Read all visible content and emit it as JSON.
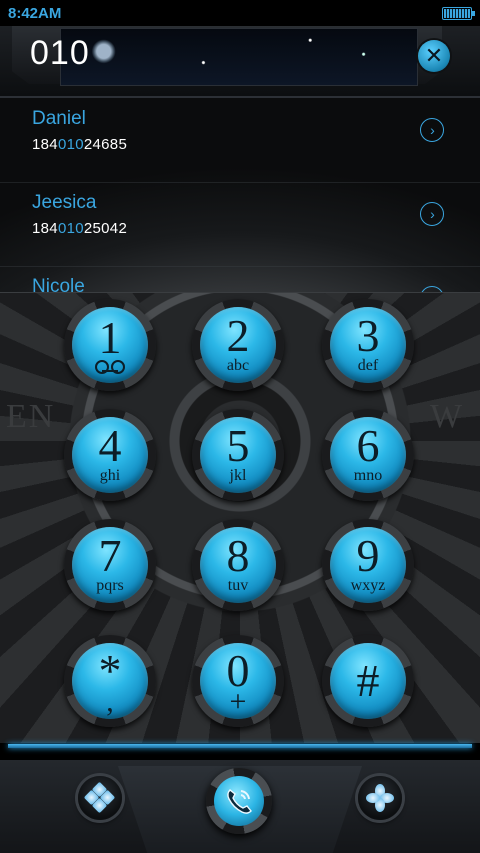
{
  "status_bar": {
    "time": "8:42AM",
    "battery_level": 1.0
  },
  "dialer": {
    "number": "010",
    "clear_symbol": "✕"
  },
  "contacts": [
    {
      "name": "Daniel",
      "number_prefix": "184",
      "number_match": "010",
      "number_suffix": "24685"
    },
    {
      "name": "Jeesica",
      "number_prefix": "184",
      "number_match": "010",
      "number_suffix": "25042"
    },
    {
      "name": "Nicole",
      "number_prefix": "",
      "number_match": "",
      "number_suffix": ""
    }
  ],
  "keypad": {
    "background_text_left": "EN",
    "background_text_right": "W",
    "keys": [
      {
        "digit": "1",
        "letters": ""
      },
      {
        "digit": "2",
        "letters": "abc"
      },
      {
        "digit": "3",
        "letters": "def"
      },
      {
        "digit": "4",
        "letters": "ghi"
      },
      {
        "digit": "5",
        "letters": "jkl"
      },
      {
        "digit": "6",
        "letters": "mno"
      },
      {
        "digit": "7",
        "letters": "pqrs"
      },
      {
        "digit": "8",
        "letters": "tuv"
      },
      {
        "digit": "9",
        "letters": "wxyz"
      },
      {
        "digit": "*",
        "letters": ","
      },
      {
        "digit": "0",
        "letters": "+"
      },
      {
        "digit": "#",
        "letters": ""
      }
    ]
  },
  "colors": {
    "accent": "#3aa6e0",
    "key_face": "#2cb8e8",
    "background": "#000000"
  },
  "bottom_bar": {
    "left_icon": "diamond-grid-icon",
    "center_icon": "phone-call-icon",
    "right_icon": "flower-icon"
  }
}
